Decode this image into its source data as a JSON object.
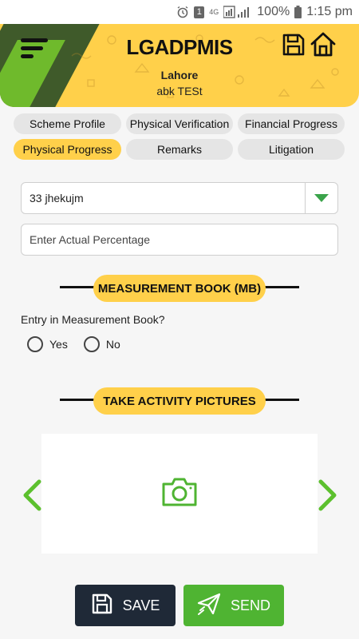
{
  "status_bar": {
    "sim": "1",
    "network": "4G",
    "battery": "100%",
    "time": "1:15 pm"
  },
  "header": {
    "title": "LGADPMIS",
    "district": "Lahore",
    "scheme": "abk TESt"
  },
  "tabs": [
    {
      "label": "Scheme Profile"
    },
    {
      "label": "Physical Verification"
    },
    {
      "label": "Financial Progress"
    },
    {
      "label": "Physical Progress"
    },
    {
      "label": "Remarks"
    },
    {
      "label": "Litigation"
    }
  ],
  "form": {
    "selected_option": "33 jhekujm",
    "percentage_placeholder": "Enter Actual Percentage",
    "percentage_value": ""
  },
  "measurement_book": {
    "heading": "MEASUREMENT BOOK (MB)",
    "question": "Entry in Measurement Book?",
    "options": [
      {
        "label": "Yes"
      },
      {
        "label": "No"
      }
    ]
  },
  "pictures": {
    "heading": "TAKE ACTIVITY PICTURES"
  },
  "actions": {
    "save_label": "SAVE",
    "send_label": "SEND"
  },
  "colors": {
    "accent": "#ffd04a",
    "green": "#4fb432",
    "dark": "#1f2937"
  }
}
